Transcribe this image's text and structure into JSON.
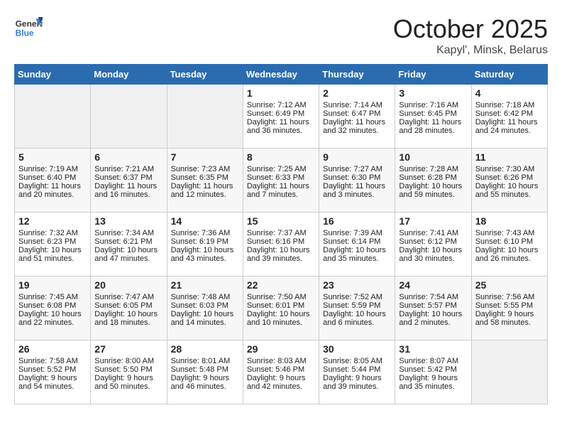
{
  "header": {
    "logo_general": "General",
    "logo_blue": "Blue",
    "title": "October 2025",
    "location": "Kapyl', Minsk, Belarus"
  },
  "weekdays": [
    "Sunday",
    "Monday",
    "Tuesday",
    "Wednesday",
    "Thursday",
    "Friday",
    "Saturday"
  ],
  "weeks": [
    [
      {
        "day": "",
        "sunrise": "",
        "sunset": "",
        "daylight": "",
        "empty": true
      },
      {
        "day": "",
        "sunrise": "",
        "sunset": "",
        "daylight": "",
        "empty": true
      },
      {
        "day": "",
        "sunrise": "",
        "sunset": "",
        "daylight": "",
        "empty": true
      },
      {
        "day": "1",
        "sunrise": "Sunrise: 7:12 AM",
        "sunset": "Sunset: 6:49 PM",
        "daylight": "Daylight: 11 hours and 36 minutes."
      },
      {
        "day": "2",
        "sunrise": "Sunrise: 7:14 AM",
        "sunset": "Sunset: 6:47 PM",
        "daylight": "Daylight: 11 hours and 32 minutes."
      },
      {
        "day": "3",
        "sunrise": "Sunrise: 7:16 AM",
        "sunset": "Sunset: 6:45 PM",
        "daylight": "Daylight: 11 hours and 28 minutes."
      },
      {
        "day": "4",
        "sunrise": "Sunrise: 7:18 AM",
        "sunset": "Sunset: 6:42 PM",
        "daylight": "Daylight: 11 hours and 24 minutes."
      }
    ],
    [
      {
        "day": "5",
        "sunrise": "Sunrise: 7:19 AM",
        "sunset": "Sunset: 6:40 PM",
        "daylight": "Daylight: 11 hours and 20 minutes."
      },
      {
        "day": "6",
        "sunrise": "Sunrise: 7:21 AM",
        "sunset": "Sunset: 6:37 PM",
        "daylight": "Daylight: 11 hours and 16 minutes."
      },
      {
        "day": "7",
        "sunrise": "Sunrise: 7:23 AM",
        "sunset": "Sunset: 6:35 PM",
        "daylight": "Daylight: 11 hours and 12 minutes."
      },
      {
        "day": "8",
        "sunrise": "Sunrise: 7:25 AM",
        "sunset": "Sunset: 6:33 PM",
        "daylight": "Daylight: 11 hours and 7 minutes."
      },
      {
        "day": "9",
        "sunrise": "Sunrise: 7:27 AM",
        "sunset": "Sunset: 6:30 PM",
        "daylight": "Daylight: 11 hours and 3 minutes."
      },
      {
        "day": "10",
        "sunrise": "Sunrise: 7:28 AM",
        "sunset": "Sunset: 6:28 PM",
        "daylight": "Daylight: 10 hours and 59 minutes."
      },
      {
        "day": "11",
        "sunrise": "Sunrise: 7:30 AM",
        "sunset": "Sunset: 6:26 PM",
        "daylight": "Daylight: 10 hours and 55 minutes."
      }
    ],
    [
      {
        "day": "12",
        "sunrise": "Sunrise: 7:32 AM",
        "sunset": "Sunset: 6:23 PM",
        "daylight": "Daylight: 10 hours and 51 minutes."
      },
      {
        "day": "13",
        "sunrise": "Sunrise: 7:34 AM",
        "sunset": "Sunset: 6:21 PM",
        "daylight": "Daylight: 10 hours and 47 minutes."
      },
      {
        "day": "14",
        "sunrise": "Sunrise: 7:36 AM",
        "sunset": "Sunset: 6:19 PM",
        "daylight": "Daylight: 10 hours and 43 minutes."
      },
      {
        "day": "15",
        "sunrise": "Sunrise: 7:37 AM",
        "sunset": "Sunset: 6:16 PM",
        "daylight": "Daylight: 10 hours and 39 minutes."
      },
      {
        "day": "16",
        "sunrise": "Sunrise: 7:39 AM",
        "sunset": "Sunset: 6:14 PM",
        "daylight": "Daylight: 10 hours and 35 minutes."
      },
      {
        "day": "17",
        "sunrise": "Sunrise: 7:41 AM",
        "sunset": "Sunset: 6:12 PM",
        "daylight": "Daylight: 10 hours and 30 minutes."
      },
      {
        "day": "18",
        "sunrise": "Sunrise: 7:43 AM",
        "sunset": "Sunset: 6:10 PM",
        "daylight": "Daylight: 10 hours and 26 minutes."
      }
    ],
    [
      {
        "day": "19",
        "sunrise": "Sunrise: 7:45 AM",
        "sunset": "Sunset: 6:08 PM",
        "daylight": "Daylight: 10 hours and 22 minutes."
      },
      {
        "day": "20",
        "sunrise": "Sunrise: 7:47 AM",
        "sunset": "Sunset: 6:05 PM",
        "daylight": "Daylight: 10 hours and 18 minutes."
      },
      {
        "day": "21",
        "sunrise": "Sunrise: 7:48 AM",
        "sunset": "Sunset: 6:03 PM",
        "daylight": "Daylight: 10 hours and 14 minutes."
      },
      {
        "day": "22",
        "sunrise": "Sunrise: 7:50 AM",
        "sunset": "Sunset: 6:01 PM",
        "daylight": "Daylight: 10 hours and 10 minutes."
      },
      {
        "day": "23",
        "sunrise": "Sunrise: 7:52 AM",
        "sunset": "Sunset: 5:59 PM",
        "daylight": "Daylight: 10 hours and 6 minutes."
      },
      {
        "day": "24",
        "sunrise": "Sunrise: 7:54 AM",
        "sunset": "Sunset: 5:57 PM",
        "daylight": "Daylight: 10 hours and 2 minutes."
      },
      {
        "day": "25",
        "sunrise": "Sunrise: 7:56 AM",
        "sunset": "Sunset: 5:55 PM",
        "daylight": "Daylight: 9 hours and 58 minutes."
      }
    ],
    [
      {
        "day": "26",
        "sunrise": "Sunrise: 7:58 AM",
        "sunset": "Sunset: 5:52 PM",
        "daylight": "Daylight: 9 hours and 54 minutes."
      },
      {
        "day": "27",
        "sunrise": "Sunrise: 8:00 AM",
        "sunset": "Sunset: 5:50 PM",
        "daylight": "Daylight: 9 hours and 50 minutes."
      },
      {
        "day": "28",
        "sunrise": "Sunrise: 8:01 AM",
        "sunset": "Sunset: 5:48 PM",
        "daylight": "Daylight: 9 hours and 46 minutes."
      },
      {
        "day": "29",
        "sunrise": "Sunrise: 8:03 AM",
        "sunset": "Sunset: 5:46 PM",
        "daylight": "Daylight: 9 hours and 42 minutes."
      },
      {
        "day": "30",
        "sunrise": "Sunrise: 8:05 AM",
        "sunset": "Sunset: 5:44 PM",
        "daylight": "Daylight: 9 hours and 39 minutes."
      },
      {
        "day": "31",
        "sunrise": "Sunrise: 8:07 AM",
        "sunset": "Sunset: 5:42 PM",
        "daylight": "Daylight: 9 hours and 35 minutes."
      },
      {
        "day": "",
        "sunrise": "",
        "sunset": "",
        "daylight": "",
        "empty": true
      }
    ]
  ]
}
